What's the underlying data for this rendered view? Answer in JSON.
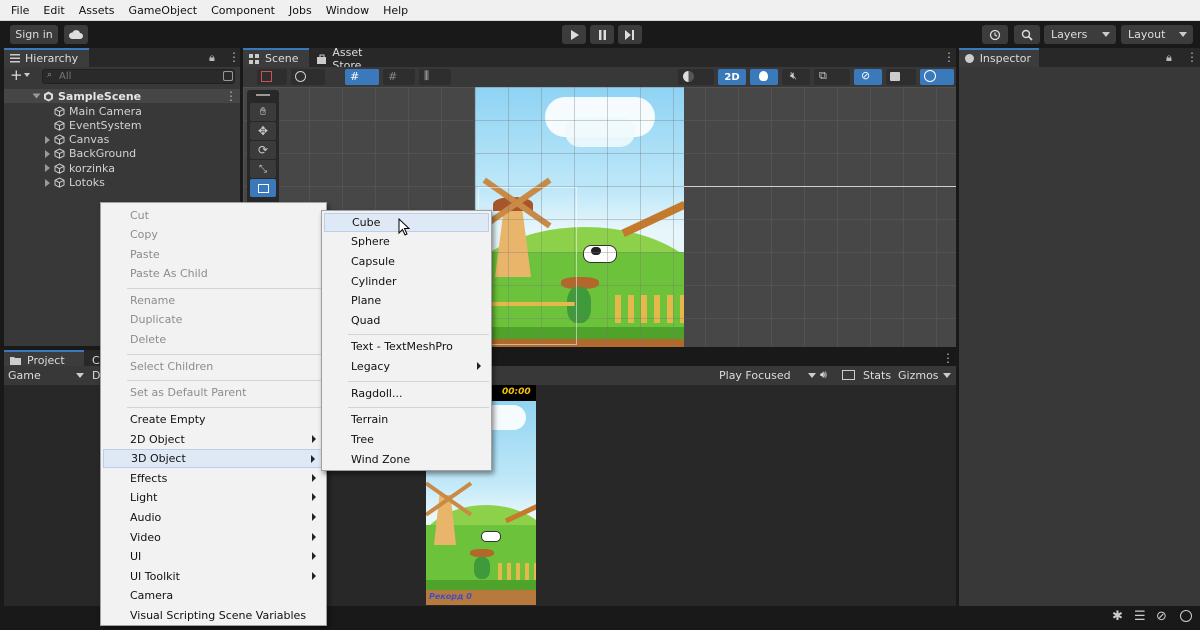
{
  "menubar": [
    "File",
    "Edit",
    "Assets",
    "GameObject",
    "Component",
    "Jobs",
    "Window",
    "Help"
  ],
  "toolbar": {
    "sign_in": "Sign in",
    "layers": "Layers",
    "layout": "Layout"
  },
  "hierarchy": {
    "tab": "Hierarchy",
    "search_placeholder": "All",
    "scene": "SampleScene",
    "items": [
      {
        "label": "Main Camera",
        "expandable": false
      },
      {
        "label": "EventSystem",
        "expandable": false
      },
      {
        "label": "Canvas",
        "expandable": true
      },
      {
        "label": "BackGround",
        "expandable": true
      },
      {
        "label": "korzinka",
        "expandable": true
      },
      {
        "label": "Lotoks",
        "expandable": true
      }
    ]
  },
  "scene": {
    "tabs": [
      "Scene",
      "Asset Store"
    ],
    "toggle_2d": "2D"
  },
  "inspector": {
    "tab": "Inspector"
  },
  "project": {
    "tab": "Project",
    "tab2": "C"
  },
  "game": {
    "dropdown": "Game",
    "display_partial": "D",
    "play_focused": "Play Focused",
    "stats": "Stats",
    "gizmos": "Gizmos",
    "timer": "00:00",
    "record": "Рекорд 0"
  },
  "context_menu": [
    {
      "label": "Cut",
      "disabled": true
    },
    {
      "label": "Copy",
      "disabled": true
    },
    {
      "label": "Paste",
      "disabled": true
    },
    {
      "label": "Paste As Child",
      "disabled": true
    },
    {
      "label": "Rename",
      "disabled": true
    },
    {
      "label": "Duplicate",
      "disabled": true
    },
    {
      "label": "Delete",
      "disabled": true
    },
    {
      "label": "Select Children",
      "disabled": true
    },
    {
      "label": "Set as Default Parent",
      "disabled": true
    },
    {
      "label": "Create Empty",
      "disabled": false
    },
    {
      "label": "2D Object",
      "disabled": false,
      "submenu": true
    },
    {
      "label": "3D Object",
      "disabled": false,
      "submenu": true,
      "selected": true
    },
    {
      "label": "Effects",
      "disabled": false,
      "submenu": true
    },
    {
      "label": "Light",
      "disabled": false,
      "submenu": true
    },
    {
      "label": "Audio",
      "disabled": false,
      "submenu": true
    },
    {
      "label": "Video",
      "disabled": false,
      "submenu": true
    },
    {
      "label": "UI",
      "disabled": false,
      "submenu": true
    },
    {
      "label": "UI Toolkit",
      "disabled": false,
      "submenu": true
    },
    {
      "label": "Camera",
      "disabled": false
    },
    {
      "label": "Visual Scripting Scene Variables",
      "disabled": false
    }
  ],
  "submenu_3d": [
    {
      "label": "Cube",
      "selected": true
    },
    {
      "label": "Sphere"
    },
    {
      "label": "Capsule"
    },
    {
      "label": "Cylinder"
    },
    {
      "label": "Plane"
    },
    {
      "label": "Quad"
    },
    {
      "label": "Text - TextMeshPro"
    },
    {
      "label": "Legacy",
      "submenu": true
    },
    {
      "label": "Ragdoll..."
    },
    {
      "label": "Terrain"
    },
    {
      "label": "Tree"
    },
    {
      "label": "Wind Zone"
    }
  ]
}
